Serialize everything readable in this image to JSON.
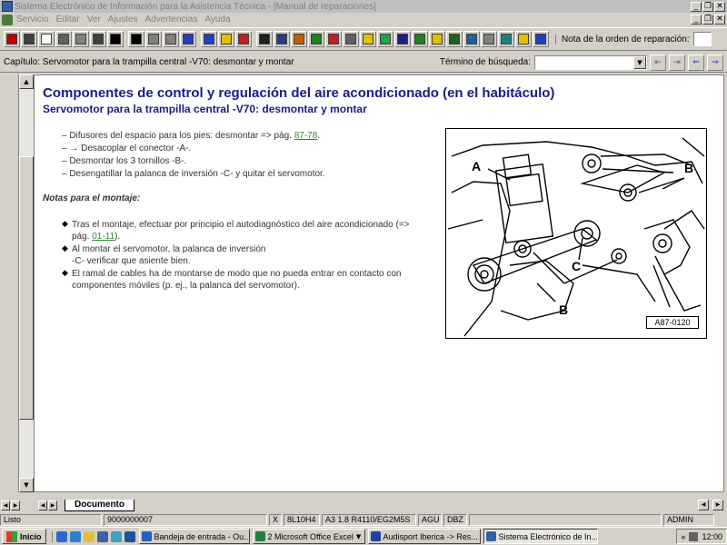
{
  "window": {
    "title": "Sistema Electrónico de Información para la Asistencia Técnica - [Manual de reparaciones]"
  },
  "menu": {
    "items": [
      "Servicio",
      "Editar",
      "Ver",
      "Ajustes",
      "Advertencias",
      "Ayuda"
    ]
  },
  "toolbar": {
    "order_label": "Nota de la orden de reparación:",
    "buttons": [
      {
        "name": "exit-icon",
        "color": "#c00000"
      },
      {
        "name": "print-icon",
        "color": "#404040"
      },
      {
        "name": "new-document-icon",
        "color": "#ffffff"
      },
      {
        "name": "edit-icon",
        "color": "#606060"
      },
      {
        "name": "notes-icon",
        "color": "#808080"
      },
      {
        "name": "vehicle-icon",
        "color": "#404040"
      },
      {
        "name": "first-page-icon",
        "color": "#000000"
      },
      {
        "name": "previous-page-icon",
        "color": "#000000"
      },
      {
        "name": "next-page-icon",
        "color": "#808080"
      },
      {
        "name": "last-page-icon",
        "color": "#808080"
      },
      {
        "name": "return-icon",
        "color": "#2040c0"
      },
      {
        "name": "info-icon",
        "color": "#2040c0"
      },
      {
        "name": "help-icon",
        "color": "#e0c000"
      },
      {
        "name": "swap-icon",
        "color": "#c02020"
      },
      {
        "name": "tools-icon",
        "color": "#202020"
      },
      {
        "name": "fuel-icon",
        "color": "#204080"
      },
      {
        "name": "grid-icon",
        "color": "#c06000"
      },
      {
        "name": "engine-icon",
        "color": "#208020"
      },
      {
        "name": "book-icon",
        "color": "#c02020"
      },
      {
        "name": "document-list-icon",
        "color": "#606060"
      },
      {
        "name": "warning-icon",
        "color": "#e0c000"
      },
      {
        "name": "globe-icon",
        "color": "#20a040"
      },
      {
        "name": "save-icon",
        "color": "#202080"
      },
      {
        "name": "green-book-icon",
        "color": "#208020"
      },
      {
        "name": "pencil-icon",
        "color": "#e0c000"
      },
      {
        "name": "car-icon",
        "color": "#206020"
      },
      {
        "name": "diagnosis-icon",
        "color": "#2060a0"
      },
      {
        "name": "checklist-icon",
        "color": "#808080"
      },
      {
        "name": "tool-icon",
        "color": "#208080"
      },
      {
        "name": "question-icon",
        "color": "#e0c000"
      },
      {
        "name": "network-icon",
        "color": "#2040c0"
      }
    ]
  },
  "chapter_bar": {
    "chapter": "Capítulo: Servomotor para la trampilla central -V70: desmontar y montar",
    "search_label": "Término de búsqueda:",
    "search_value": ""
  },
  "document": {
    "title": "Componentes de control y regulación del aire acondicionado (en el habitáculo)",
    "subtitle": "Servomotor para la trampilla central -V70: desmontar y montar",
    "steps": [
      {
        "text": "– Difusores del espacio para los pies: desmontar => pág. ",
        "link": "87-78",
        "after": "."
      },
      {
        "text": "– → Desacoplar el conector -A-.",
        "link": "",
        "after": ""
      },
      {
        "text": "– Desmontar los 3 tornillos -B-.",
        "link": "",
        "after": ""
      },
      {
        "text": "– Desengatillar la palanca de inversión -C- y quitar el servomotor.",
        "link": "",
        "after": ""
      }
    ],
    "notes_heading": "Notas para el montaje:",
    "notes": [
      {
        "line1": "Tras el montaje, efectuar por principio el autodiagnóstico del aire acondicionado (=>",
        "line2_pre": "pág. ",
        "link": "01-11",
        "line2_post": ")."
      },
      {
        "line1": "Al montar el servomotor, la palanca de inversión",
        "line2_pre": "-C- verificar que asiente bien.",
        "link": "",
        "line2_post": ""
      },
      {
        "line1": "El ramal de cables ha de montarse de modo que no pueda entrar en contacto con",
        "line2_pre": "componentes móviles (p. ej., la palanca del servomotor).",
        "link": "",
        "line2_post": ""
      }
    ],
    "figure": {
      "label_a": "A",
      "label_b1": "B",
      "label_b2": "B",
      "label_c": "C",
      "code": "A87-0120"
    }
  },
  "tabs": {
    "document_tab": "Documento"
  },
  "status": {
    "state": "Listo",
    "order_no": "9000000007",
    "x": "X",
    "engine": "8L10H4",
    "model": "A3 1.8 R4110/EG2M5S",
    "code1": "AGU",
    "code2": "DBZ",
    "user": "ADMIN"
  },
  "taskbar": {
    "start": "Inicio",
    "tasks": [
      {
        "label": "Bandeja de entrada - Ou...",
        "color": "#2060c0",
        "active": false
      },
      {
        "label": "2 Microsoft Office Excel",
        "color": "#208040",
        "active": false
      },
      {
        "label": "Audisport Iberica -> Res...",
        "color": "#2040a0",
        "active": false
      },
      {
        "label": "Sistema Electrónico de In...",
        "color": "#3060a0",
        "active": true
      }
    ],
    "clock": "12:00",
    "tray_chevron": "«"
  }
}
